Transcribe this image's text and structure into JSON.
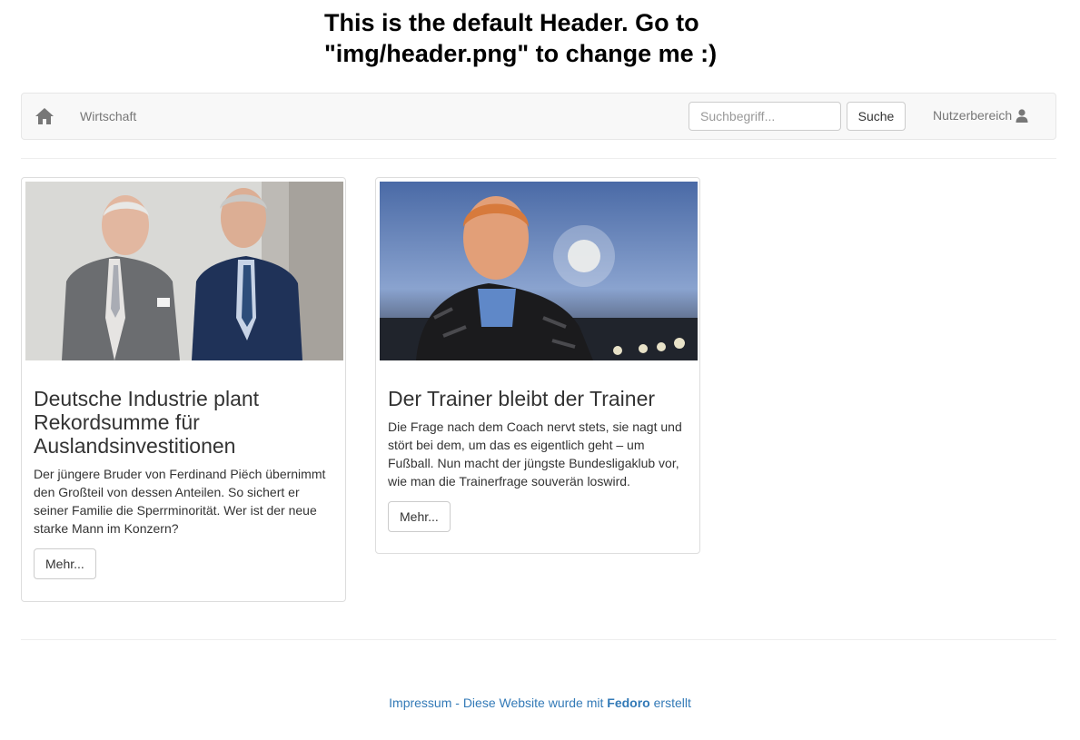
{
  "header": {
    "line1": "This is the default Header. Go to",
    "line2": "\"img/header.png\" to change me :)"
  },
  "navbar": {
    "home_icon": "home-icon",
    "link": "Wirtschaft",
    "search_placeholder": "Suchbegriff...",
    "search_button": "Suche",
    "user_label": "Nutzerbereich",
    "user_icon": "user-icon"
  },
  "articles": [
    {
      "title": "Deutsche Industrie plant Rekordsumme für Auslandsinvestitionen",
      "text": "Der jüngere Bruder von Ferdinand Piëch übernimmt den Großteil von dessen Anteilen. So sichert er seiner Familie die Sperrminorität. Wer ist der neue starke Mann im Konzern?",
      "button": "Mehr..."
    },
    {
      "title": "Der Trainer bleibt der Trainer",
      "text": "Die Frage nach dem Coach nervt stets, sie nagt und stört bei dem, um das es eigentlich geht – um Fußball. Nun macht der jüngste Bundesligaklub vor, wie man die Trainerfrage souverän loswird.",
      "button": "Mehr..."
    }
  ],
  "footer": {
    "impressum": "Impressum",
    "sep": " - Diese Website wurde mit ",
    "brand": "Fedoro",
    "suffix": " erstellt"
  },
  "colors": {
    "link": "#337ab7",
    "navbar_bg": "#f8f8f8",
    "nav_text": "#777777"
  }
}
